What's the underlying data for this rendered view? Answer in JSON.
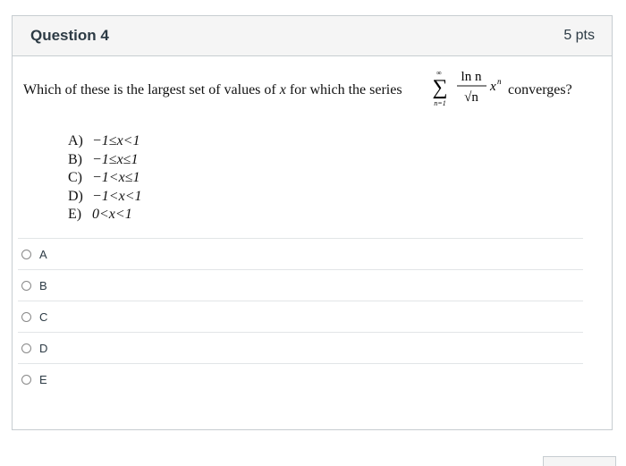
{
  "question": {
    "title": "Question 4",
    "points": "5 pts",
    "stem_before": "Which of these is the largest set of values of",
    "stem_var": "x",
    "stem_middle": "for which the series",
    "stem_after": "converges?",
    "series": {
      "upper": "∞",
      "lower": "n=1",
      "numerator": "ln n",
      "denominator": "√n",
      "factor": "x",
      "exponent": "n"
    },
    "choices": [
      {
        "letter": "A)",
        "expr": "−1≤x<1"
      },
      {
        "letter": "B)",
        "expr": "−1≤x≤1"
      },
      {
        "letter": "C)",
        "expr": "−1<x≤1"
      },
      {
        "letter": "D)",
        "expr": "−1<x<1"
      },
      {
        "letter": "E)",
        "expr": "0<x<1"
      }
    ]
  },
  "answers": [
    {
      "label": "A"
    },
    {
      "label": "B"
    },
    {
      "label": "C"
    },
    {
      "label": "D"
    },
    {
      "label": "E"
    }
  ]
}
